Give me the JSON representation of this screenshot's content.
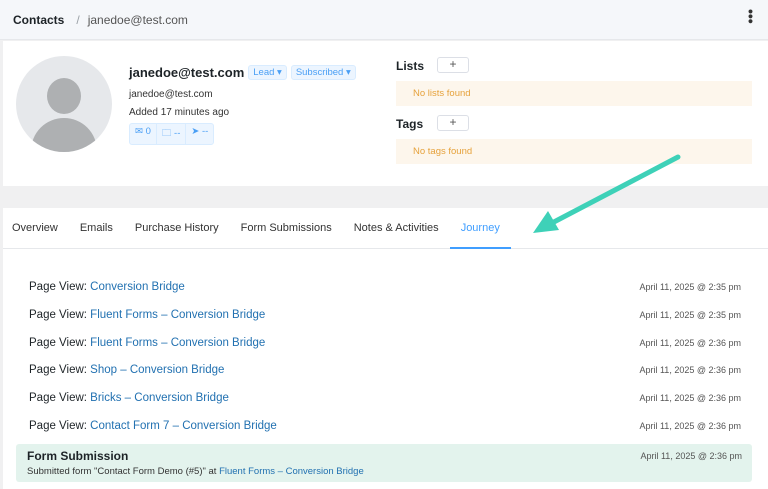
{
  "breadcrumb": {
    "root": "Contacts",
    "separator": "/",
    "current": "janedoe@test.com"
  },
  "profile": {
    "name": "janedoe@test.com",
    "type_badge": "Lead ▾",
    "status_badge": "Subscribed ▾",
    "email": "janedoe@test.com",
    "added": "Added 17 minutes ago",
    "stats": {
      "emails": "✉ 0",
      "folders": "🗀 --",
      "location": "➤ --"
    }
  },
  "lists": {
    "label": "Lists",
    "add": "+",
    "empty": "No lists found"
  },
  "tags": {
    "label": "Tags",
    "add": "+",
    "empty": "No tags found"
  },
  "tabs": [
    {
      "label": "Overview"
    },
    {
      "label": "Emails"
    },
    {
      "label": "Purchase History"
    },
    {
      "label": "Form Submissions"
    },
    {
      "label": "Notes & Activities"
    },
    {
      "label": "Journey",
      "active": true
    }
  ],
  "journey": [
    {
      "prefix": "Page View:",
      "link": "Conversion Bridge",
      "date": "April 11, 2025 @ 2:35 pm"
    },
    {
      "prefix": "Page View:",
      "link": "Fluent Forms – Conversion Bridge",
      "date": "April 11, 2025 @ 2:35 pm"
    },
    {
      "prefix": "Page View:",
      "link": "Fluent Forms – Conversion Bridge",
      "date": "April 11, 2025 @ 2:36 pm"
    },
    {
      "prefix": "Page View:",
      "link": "Shop – Conversion Bridge",
      "date": "April 11, 2025 @ 2:36 pm"
    },
    {
      "prefix": "Page View:",
      "link": "Bricks – Conversion Bridge",
      "date": "April 11, 2025 @ 2:36 pm"
    },
    {
      "prefix": "Page View:",
      "link": "Contact Form 7 – Conversion Bridge",
      "date": "April 11, 2025 @ 2:36 pm"
    }
  ],
  "form_submission": {
    "title": "Form Submission",
    "date": "April 11, 2025 @ 2:36 pm",
    "text": "Submitted form \"Contact Form Demo (#5)\" at",
    "link": "Fluent Forms – Conversion Bridge"
  },
  "colors": {
    "accent": "#409eff",
    "link": "#2271b1",
    "annotation_arrow": "#3ed1b8",
    "empty_bg": "#fdf6ec",
    "submission_bg": "#e3f3ed"
  }
}
